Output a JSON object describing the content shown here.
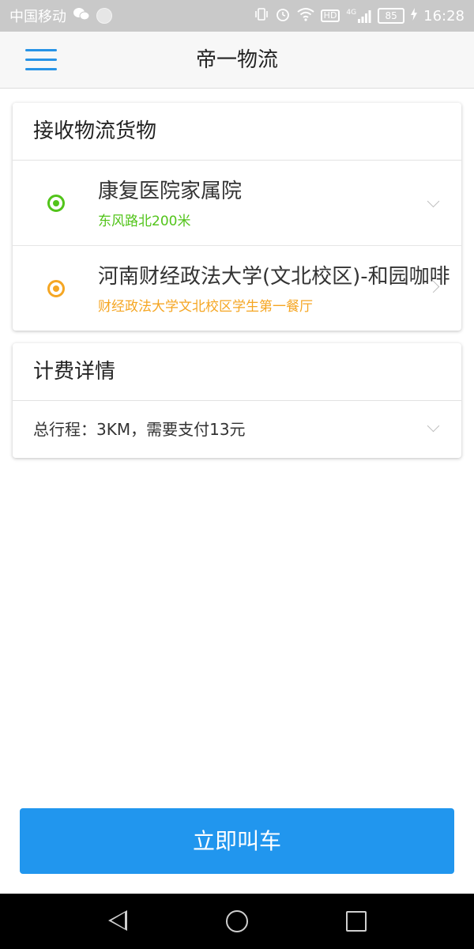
{
  "status_bar": {
    "carrier": "中国移动",
    "network": "4G",
    "hd": "HD",
    "battery": "85",
    "time": "16:28"
  },
  "app_bar": {
    "title": "帝一物流"
  },
  "receive_card": {
    "header": "接收物流货物",
    "items": [
      {
        "name": "康复医院家属院",
        "address": "东风路北200米",
        "color": "#52c41a"
      },
      {
        "name": "河南财经政法大学(文北校区)-和园咖啡",
        "address": "财经政法大学文北校区学生第一餐厅",
        "color": "#f5a623"
      }
    ]
  },
  "fee_card": {
    "header": "计费详情",
    "summary": "总行程：3KM，需要支付13元"
  },
  "call_button": {
    "label": "立即叫车"
  },
  "colors": {
    "accent": "#2196ee",
    "status_bar": "#c9c9c9",
    "nav_bar": "#000000"
  }
}
